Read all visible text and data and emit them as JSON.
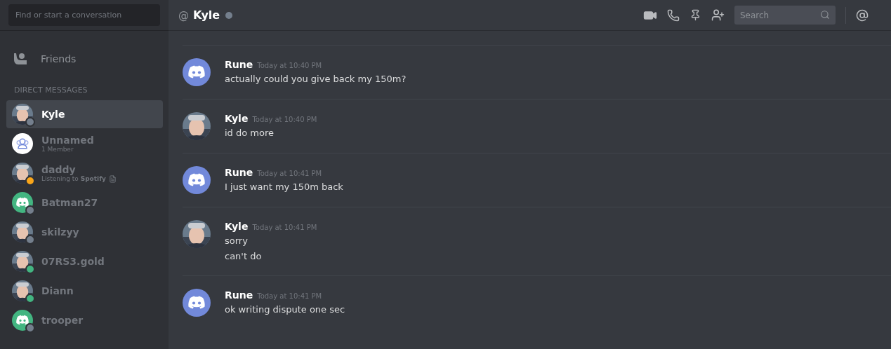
{
  "sidebar": {
    "search": {
      "placeholder": "Find or start a conversation"
    },
    "friends": {
      "label": "Friends"
    },
    "section_title": "DIRECT MESSAGES",
    "items": [
      {
        "name": "Kyle",
        "selected": true,
        "avatar": {
          "kind": "picture"
        },
        "color": "#747f8d"
      },
      {
        "name": "Unnamed",
        "subtitle": "1 Member",
        "selected": false,
        "avatar": {
          "kind": "group"
        }
      },
      {
        "name": "daddy",
        "subtitle": "Listening to **Spotify**",
        "activity_icon": true,
        "selected": false,
        "avatar": {
          "kind": "picture"
        },
        "color": "#faa61a"
      },
      {
        "name": "Batman27",
        "selected": false,
        "avatar": {
          "kind": "logo",
          "color": "#43b581"
        },
        "color": "#747f8d"
      },
      {
        "name": "skilzyy",
        "selected": false,
        "avatar": {
          "kind": "picture"
        },
        "color": "#747f8d"
      },
      {
        "name": "07RS3.gold",
        "selected": false,
        "avatar": {
          "kind": "picture"
        },
        "color": "#43b581"
      },
      {
        "name": "Diann",
        "selected": false,
        "avatar": {
          "kind": "picture"
        },
        "color": "#43b581"
      },
      {
        "name": "trooper",
        "selected": false,
        "avatar": {
          "kind": "logo",
          "color": "#43b581"
        },
        "color": "#747f8d"
      }
    ]
  },
  "header": {
    "at": "@",
    "title": "Kyle",
    "status": {
      "color": "#747f8d"
    },
    "search": {
      "placeholder": "Search"
    }
  },
  "messages": [
    {
      "author": "Rune",
      "time": "Today at 10:40 PM",
      "avatar": {
        "kind": "logo",
        "color": "#7289da"
      },
      "lines": [
        "actually could you give back my 150m?"
      ]
    },
    {
      "author": "Kyle",
      "time": "Today at 10:40 PM",
      "avatar": {
        "kind": "picture"
      },
      "lines": [
        "id do more"
      ]
    },
    {
      "author": "Rune",
      "time": "Today at 10:41 PM",
      "avatar": {
        "kind": "logo",
        "color": "#7289da"
      },
      "lines": [
        "I just want my 150m back"
      ]
    },
    {
      "author": "Kyle",
      "time": "Today at 10:41 PM",
      "avatar": {
        "kind": "picture"
      },
      "lines": [
        "sorry",
        "can't do"
      ]
    },
    {
      "author": "Rune",
      "time": "Today at 10:41 PM",
      "avatar": {
        "kind": "logo",
        "color": "#7289da"
      },
      "lines": [
        "ok writing dispute one sec"
      ]
    }
  ]
}
